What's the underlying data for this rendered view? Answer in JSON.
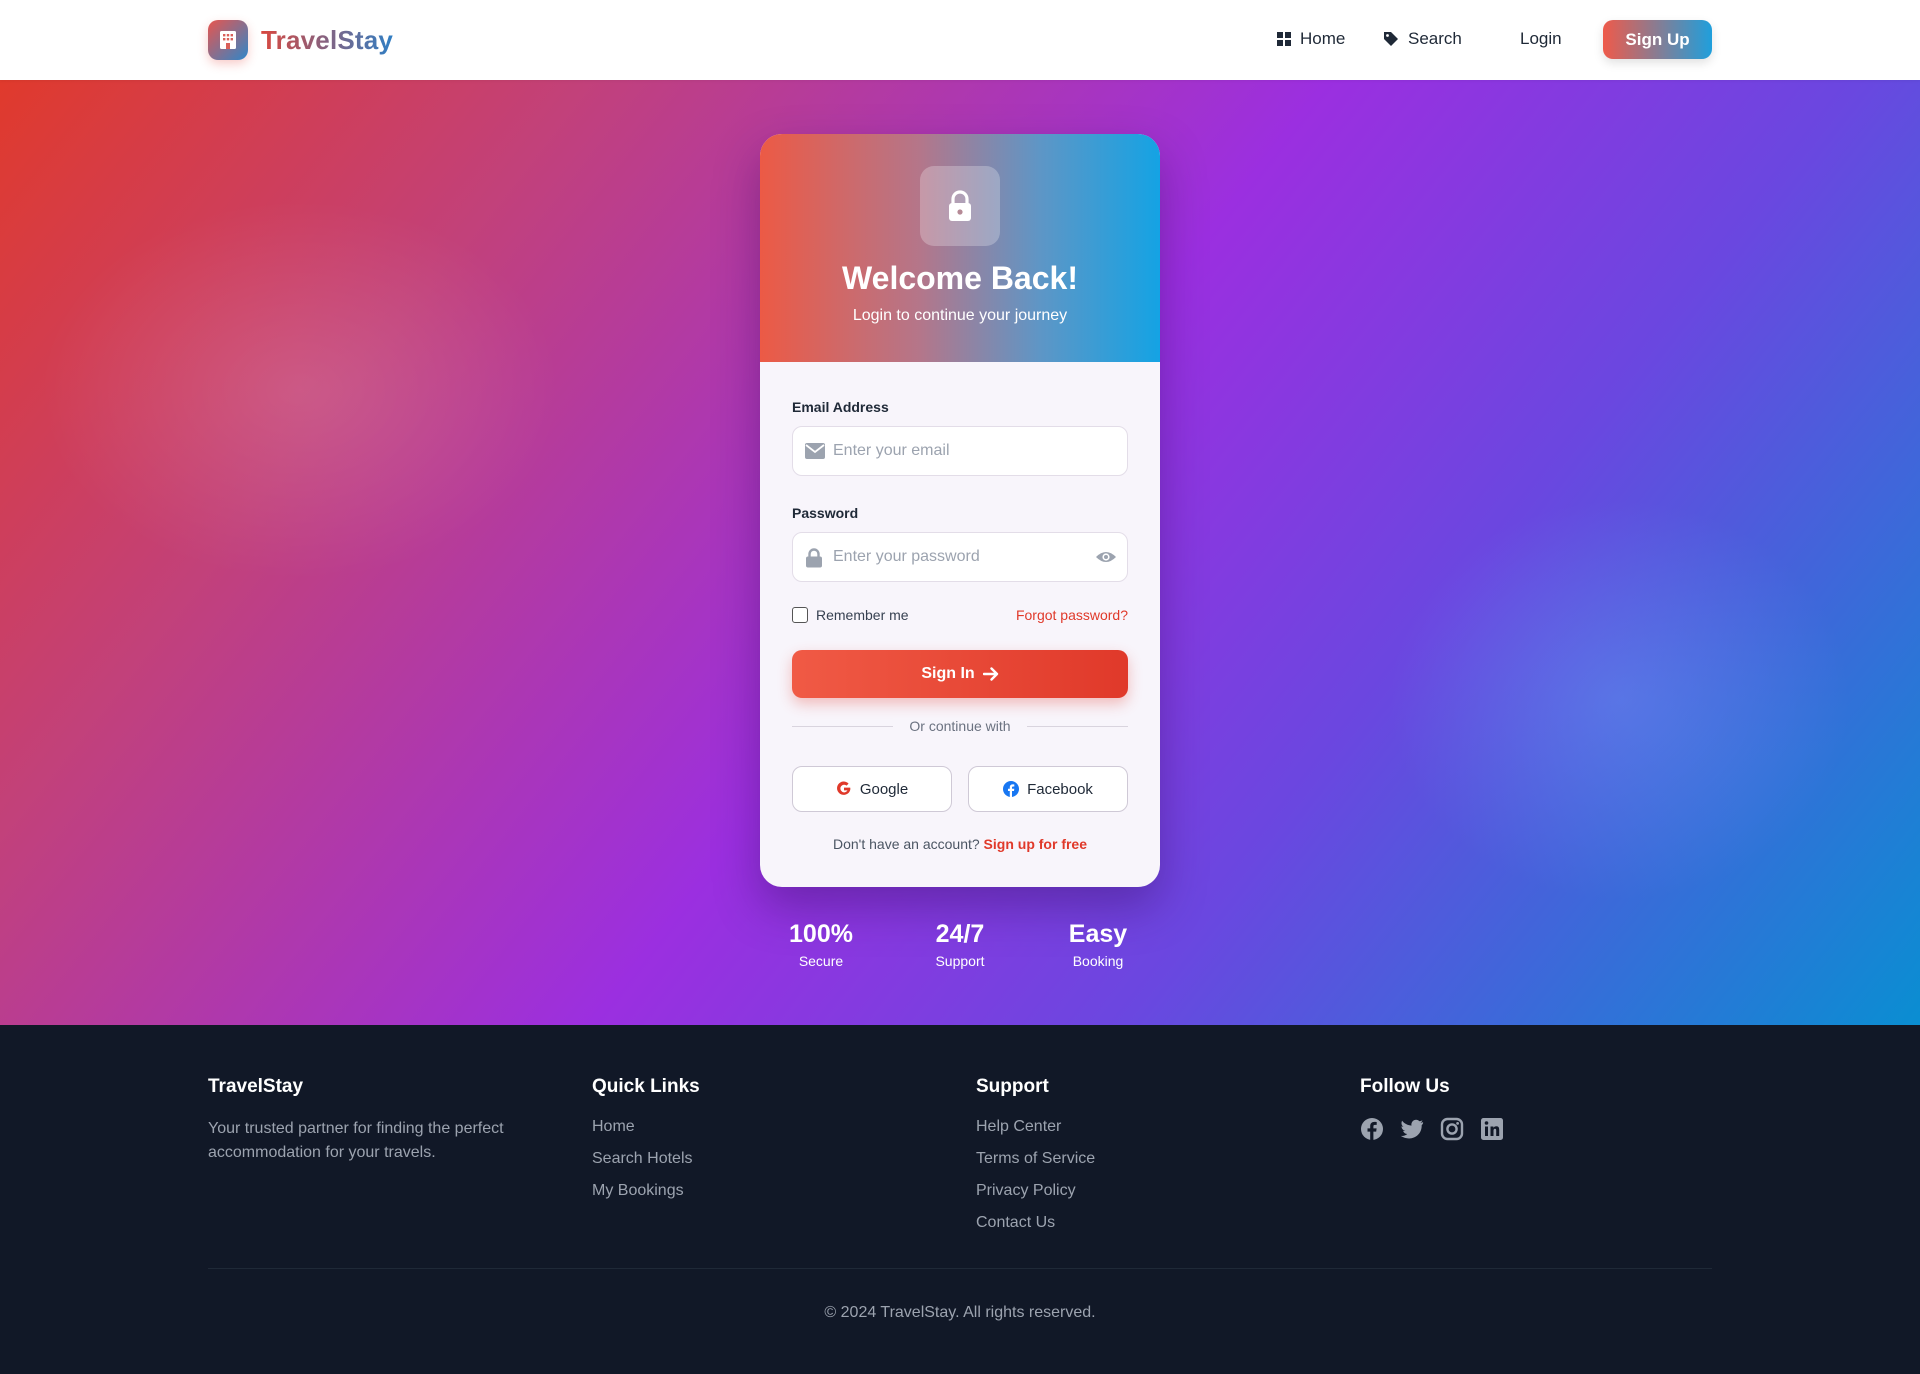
{
  "header": {
    "brand": "TravelStay",
    "nav": {
      "home": "Home",
      "search": "Search",
      "login": "Login",
      "signup": "Sign Up"
    }
  },
  "login_card": {
    "title": "Welcome Back!",
    "subtitle": "Login to continue your journey",
    "email_label": "Email Address",
    "email_placeholder": "Enter your email",
    "password_label": "Password",
    "password_placeholder": "Enter your password",
    "remember_label": "Remember me",
    "forgot_link": "Forgot password?",
    "signin_button": "Sign In",
    "divider_text": "Or continue with",
    "google_button": "Google",
    "facebook_button": "Facebook",
    "no_account_text": "Don't have an account?",
    "signup_link": "Sign up for free"
  },
  "stats": [
    {
      "value": "100%",
      "label": "Secure"
    },
    {
      "value": "24/7",
      "label": "Support"
    },
    {
      "value": "Easy",
      "label": "Booking"
    }
  ],
  "footer": {
    "brand": "TravelStay",
    "about": "Your trusted partner for finding the perfect accommodation for your travels.",
    "quick_links_title": "Quick Links",
    "quick_links": [
      "Home",
      "Search Hotels",
      "My Bookings"
    ],
    "support_title": "Support",
    "support_links": [
      "Help Center",
      "Terms of Service",
      "Privacy Policy",
      "Contact Us"
    ],
    "follow_title": "Follow Us",
    "social_icons": [
      "facebook-icon",
      "twitter-icon",
      "instagram-icon",
      "linkedin-icon"
    ],
    "copyright": "© 2024 TravelStay. All rights reserved."
  },
  "colors": {
    "accent_red": "#e0392a",
    "brand_blue": "#2f7ec4",
    "footer_bg": "#111827"
  }
}
